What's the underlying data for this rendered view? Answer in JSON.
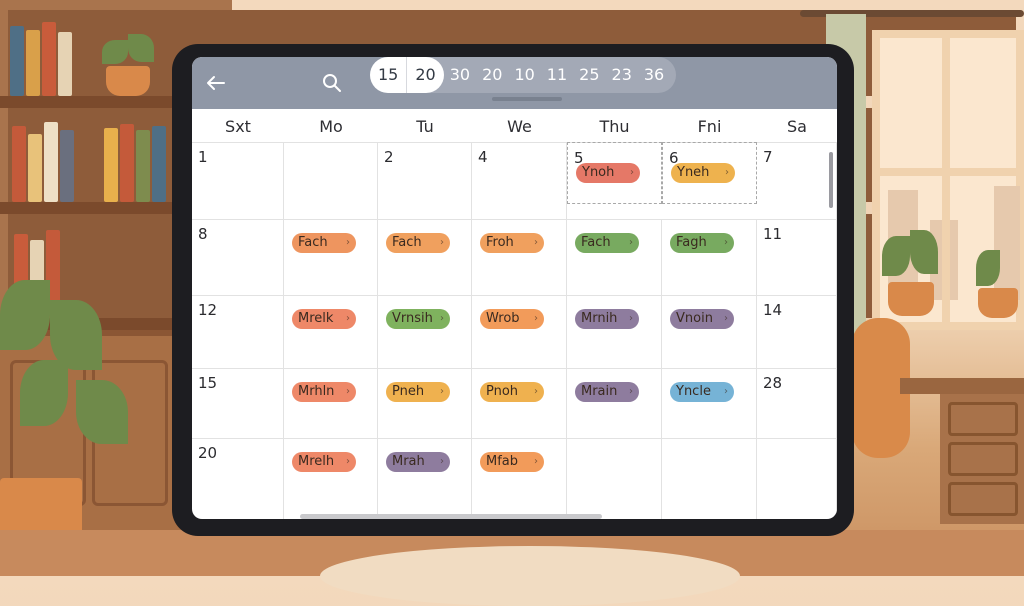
{
  "toolbar": {
    "zoom_active": [
      "15",
      "20"
    ],
    "zoom_options": [
      "30",
      "20",
      "10",
      "11",
      "25",
      "23",
      "36"
    ]
  },
  "weekdays": [
    "Sxt",
    "Mo",
    "Tu",
    "We",
    "Thu",
    "Fni",
    "Sa"
  ],
  "rows": [
    {
      "cells": [
        {
          "day": "1"
        },
        {
          "day": ""
        },
        {
          "day": "2"
        },
        {
          "day": "4"
        },
        {
          "day": "5",
          "selected": true,
          "event": {
            "label": "Ynoh",
            "color": "#e57867"
          }
        },
        {
          "day": "6",
          "selected": true,
          "event": {
            "label": "Yneh",
            "color": "#eeb24e"
          }
        },
        {
          "day": "7"
        }
      ]
    },
    {
      "cells": [
        {
          "day": "8"
        },
        {
          "day": "",
          "event": {
            "label": "Fach",
            "color": "#ee955f"
          }
        },
        {
          "day": "",
          "event": {
            "label": "Fach",
            "color": "#f0a05e"
          }
        },
        {
          "day": "",
          "event": {
            "label": "Froh",
            "color": "#f0a05e"
          }
        },
        {
          "day": "",
          "event": {
            "label": "Fach",
            "color": "#78aa60"
          }
        },
        {
          "day": "",
          "event": {
            "label": "Fagh",
            "color": "#78aa60"
          }
        },
        {
          "day": "11"
        }
      ]
    },
    {
      "cells": [
        {
          "day": "12"
        },
        {
          "day": "",
          "event": {
            "label": "Mrelk",
            "color": "#ee8868"
          }
        },
        {
          "day": "",
          "event": {
            "label": "Vrnsih",
            "color": "#7fb25e"
          }
        },
        {
          "day": "",
          "event": {
            "label": "Wrob",
            "color": "#f29b5a"
          }
        },
        {
          "day": "",
          "event": {
            "label": "Mrnih",
            "color": "#8e7c9e"
          }
        },
        {
          "day": "",
          "event": {
            "label": "Vnoin",
            "color": "#8e7c9e"
          }
        },
        {
          "day": "14"
        }
      ]
    },
    {
      "cells": [
        {
          "day": "15"
        },
        {
          "day": "",
          "event": {
            "label": "Mrhln",
            "color": "#ee8868"
          }
        },
        {
          "day": "",
          "event": {
            "label": "Pneh",
            "color": "#efb14f"
          }
        },
        {
          "day": "",
          "event": {
            "label": "Pnoh",
            "color": "#efb14f"
          }
        },
        {
          "day": "",
          "event": {
            "label": "Mrain",
            "color": "#8e7c9e"
          }
        },
        {
          "day": "",
          "event": {
            "label": "Yncle",
            "color": "#76b3d6"
          }
        },
        {
          "day": "28"
        }
      ]
    },
    {
      "cells": [
        {
          "day": "20"
        },
        {
          "day": "",
          "event": {
            "label": "Mrelh",
            "color": "#ee8868"
          }
        },
        {
          "day": "",
          "event": {
            "label": "Mrah",
            "color": "#8e7c9e"
          }
        },
        {
          "day": "",
          "event": {
            "label": "Mfab",
            "color": "#f29b5a"
          }
        },
        {
          "day": ""
        },
        {
          "day": ""
        },
        {
          "day": ""
        }
      ]
    }
  ]
}
